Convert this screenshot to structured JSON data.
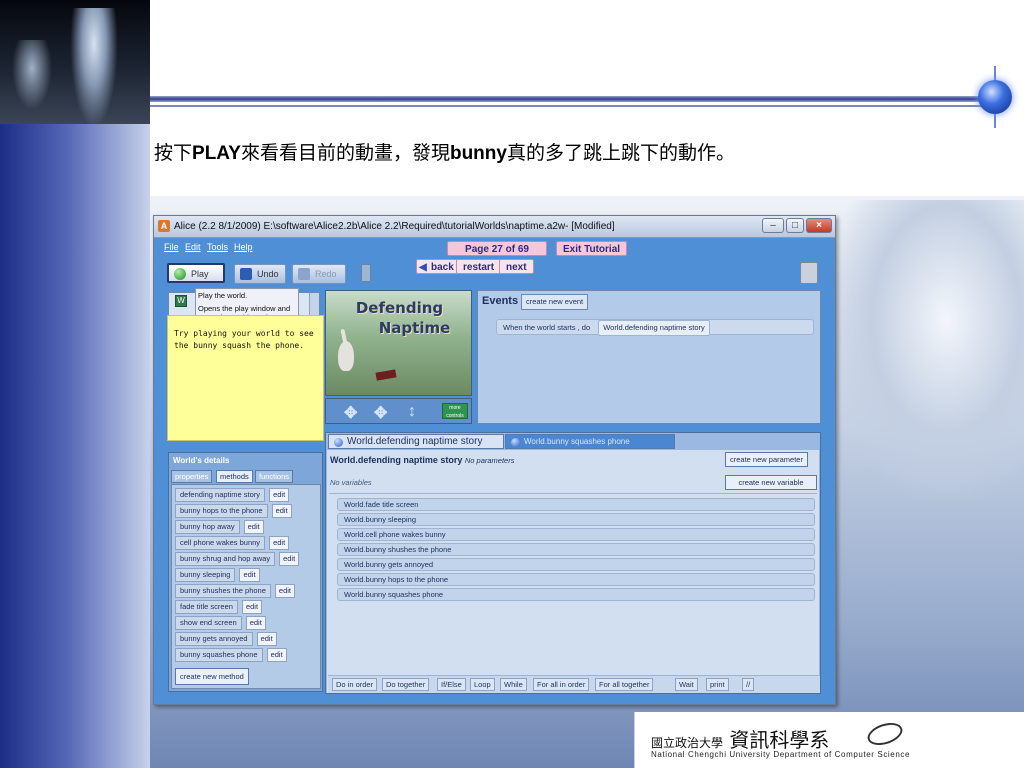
{
  "slide": {
    "heading_pre": "按下",
    "heading_b1": "PLAY",
    "heading_mid": "來看看目前的動畫，發現",
    "heading_b2": "bunny",
    "heading_post": "真的多了跳上跳下的動作。",
    "footer_zh_small": "國立政治大學",
    "footer_zh": "資訊科學系",
    "footer_en": "National Chengchi University Department of Computer Science"
  },
  "alice": {
    "title": "Alice (2.2  8/1/2009) E:\\software\\Alice2.2b\\Alice 2.2\\Required\\tutorialWorlds\\naptime.a2w-  [Modified]",
    "menu": [
      "File",
      "Edit",
      "Tools",
      "Help"
    ],
    "tutorial": {
      "page": "Page 27 of 69",
      "exit": "Exit Tutorial",
      "back": "back",
      "restart": "restart",
      "next": "next"
    },
    "toolbar": {
      "play": "Play",
      "undo": "Undo",
      "redo": "Redo"
    },
    "tree_label": "W",
    "tooltip": {
      "line1": "Play the world.",
      "line2": "Opens the play window and starts the world running."
    },
    "sticky_note": "Try playing your world to see the bunny squash the phone.",
    "world_view": {
      "line1": "Defending",
      "line2": "Naptime",
      "more_controls": "more controls"
    },
    "events": {
      "label": "Events",
      "create_btn": "create new event",
      "row_text": "When the world starts , do",
      "row_value": "World.defending naptime story"
    },
    "details": {
      "title": "World's details",
      "tabs": [
        "properties",
        "methods",
        "functions"
      ],
      "methods": [
        "defending naptime story",
        "bunny hops to the phone",
        "bunny hop away",
        "cell phone wakes bunny",
        "bunny shrug and hop away",
        "bunny sleeping",
        "bunny shushes the phone",
        "fade title screen",
        "show end screen",
        "bunny gets annoyed",
        "bunny squashes phone"
      ],
      "edit_label": "edit",
      "create_method": "create new method"
    },
    "editor": {
      "tab_active": "World.defending naptime story",
      "tab_inactive": "World.bunny squashes phone",
      "method_name": "World.defending naptime story",
      "no_params": "No parameters",
      "no_vars": "No variables",
      "create_param": "create new parameter",
      "create_var": "create new variable",
      "statements": [
        "World.fade title screen",
        "World.bunny sleeping",
        "World.cell phone wakes bunny",
        "World.bunny shushes the phone",
        "World.bunny gets annoyed",
        "World.bunny hops to the phone",
        "World.bunny squashes phone"
      ],
      "controls": [
        "Do in order",
        "Do together",
        "If/Else",
        "Loop",
        "While",
        "For all in order",
        "For all together",
        "Wait",
        "print",
        "//"
      ]
    }
  }
}
